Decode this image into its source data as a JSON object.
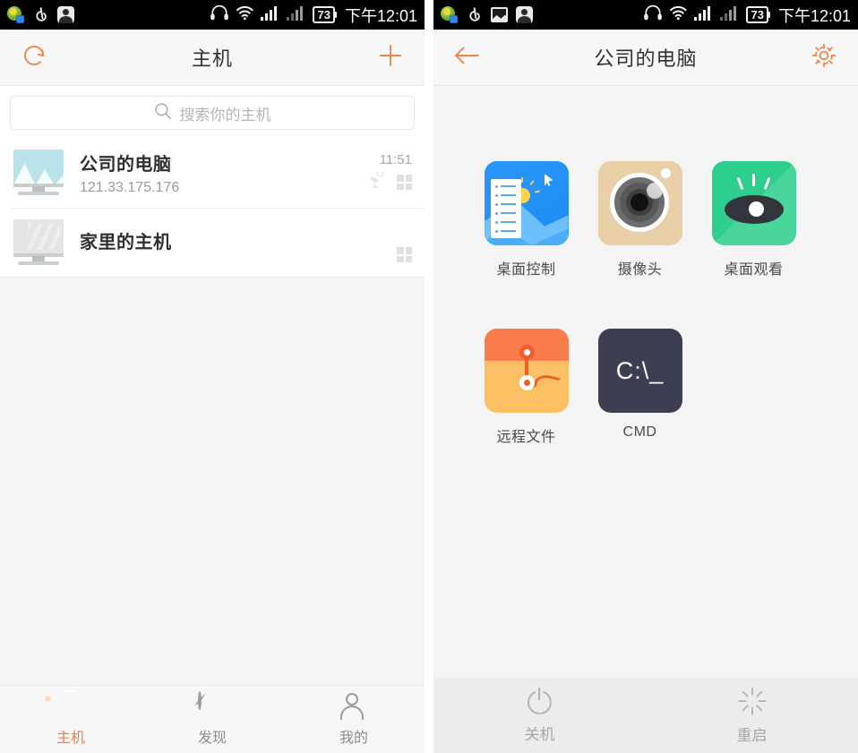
{
  "statusbar": {
    "left_icons_panel_a": [
      "globe-app-icon",
      "netease-music-icon",
      "user-app-icon"
    ],
    "left_icons_panel_b": [
      "globe-app-icon",
      "netease-music-icon",
      "gallery-app-icon",
      "user-app-icon"
    ],
    "headphone_icon": "headphone-icon",
    "wifi_icon": "wifi-icon",
    "signal_icon_1": "signal-bars-icon",
    "signal_icon_2": "signal-bars-icon",
    "battery_level": "73",
    "time": "下午12:01"
  },
  "left_screen": {
    "navbar": {
      "refresh_icon": "refresh-icon",
      "title": "主机",
      "add_icon": "plus-icon"
    },
    "search": {
      "icon": "search-icon",
      "placeholder": "搜索你的主机",
      "value": ""
    },
    "hosts": [
      {
        "name": "公司的电脑",
        "ip": "121.33.175.176",
        "time": "11:51",
        "state": "online",
        "badges": [
          "satellite-dish-icon",
          "windows-logo-icon"
        ]
      },
      {
        "name": "家里的主机",
        "ip": "",
        "time": "",
        "state": "offline",
        "badges": [
          "windows-logo-icon"
        ]
      }
    ],
    "tabs": [
      {
        "label": "主机",
        "icon": "host-icon",
        "active": true
      },
      {
        "label": "发现",
        "icon": "compass-icon",
        "active": false
      },
      {
        "label": "我的",
        "icon": "person-icon",
        "active": false
      }
    ]
  },
  "right_screen": {
    "navbar": {
      "back_icon": "arrow-left-icon",
      "title": "公司的电脑",
      "settings_icon": "gear-icon"
    },
    "apps": [
      [
        {
          "label": "桌面控制",
          "icon": "desktop-control-icon"
        },
        {
          "label": "摄像头",
          "icon": "camera-icon"
        },
        {
          "label": "桌面观看",
          "icon": "eye-watch-icon"
        }
      ],
      [
        {
          "label": "远程文件",
          "icon": "remote-file-icon"
        },
        {
          "label": "CMD",
          "icon": "cmd-icon",
          "glyph": "C:\\_"
        }
      ]
    ],
    "actions": [
      {
        "label": "关机",
        "icon": "power-icon"
      },
      {
        "label": "重启",
        "icon": "restart-icon"
      }
    ]
  },
  "colors": {
    "accent_orange": "#f4834a",
    "nav_bg": "#f7f7f7",
    "screen_bg": "#f4f4f4",
    "text_primary": "#2f3033",
    "text_muted": "#9a9a9a",
    "blue_app": "#1b8df5",
    "beige_app": "#e9cfa8",
    "green_app": "#2ecf8e",
    "orange_app": "#fcc064",
    "cmd_dark": "#3b3f51"
  }
}
